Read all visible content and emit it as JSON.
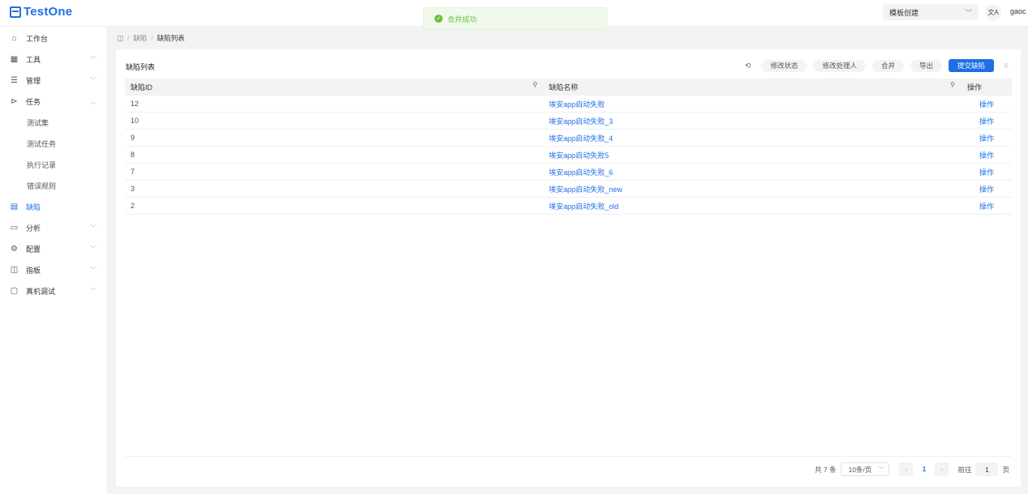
{
  "app": {
    "logo_text": "TestOne"
  },
  "header": {
    "template_select": "模板创建",
    "lang_icon": "文A",
    "user": "gaoc"
  },
  "toast": {
    "message": "合并成功"
  },
  "sidebar": {
    "items": [
      {
        "label": "工作台",
        "icon": "home-icon",
        "glyph": "⌂",
        "chevron": ""
      },
      {
        "label": "工具",
        "icon": "grid-icon",
        "glyph": "▦",
        "chevron": "﹀"
      },
      {
        "label": "管理",
        "icon": "list-icon",
        "glyph": "☰",
        "chevron": "﹀"
      },
      {
        "label": "任务",
        "icon": "send-icon",
        "glyph": "⊳",
        "chevron": "︿"
      },
      {
        "label": "测试集",
        "sub": true
      },
      {
        "label": "测试任务",
        "sub": true
      },
      {
        "label": "执行记录",
        "sub": true
      },
      {
        "label": "错误规则",
        "sub": true
      },
      {
        "label": "缺陷",
        "icon": "document-icon",
        "glyph": "▤",
        "chevron": "",
        "active": true
      },
      {
        "label": "分析",
        "icon": "calendar-icon",
        "glyph": "▭",
        "chevron": "﹀"
      },
      {
        "label": "配置",
        "icon": "gear-icon",
        "glyph": "⚙",
        "chevron": "﹀"
      },
      {
        "label": "指板",
        "icon": "panel-icon",
        "glyph": "◫",
        "chevron": "﹀"
      },
      {
        "label": "真机调试",
        "icon": "device-icon",
        "glyph": "▢",
        "chevron": "﹀"
      }
    ]
  },
  "breadcrumb": {
    "level1": "缺陷",
    "level2": "缺陷列表"
  },
  "card": {
    "title": "缺陷列表",
    "toolbar": {
      "refresh": "⟲",
      "edit_status": "修改状态",
      "edit_handler": "修改处理人",
      "merge": "合并",
      "export": "导出",
      "submit": "提交缺陷"
    }
  },
  "table": {
    "headers": {
      "id": "缺陷ID",
      "name": "缺陷名称",
      "op": "操作"
    },
    "rows": [
      {
        "id": "12",
        "name": "埃安app启动失败",
        "op": "操作"
      },
      {
        "id": "10",
        "name": "埃安app启动失败_3",
        "op": "操作"
      },
      {
        "id": "9",
        "name": "埃安app启动失败_4",
        "op": "操作"
      },
      {
        "id": "8",
        "name": "埃安app启动失败5",
        "op": "操作"
      },
      {
        "id": "7",
        "name": "埃安app启动失败_6",
        "op": "操作"
      },
      {
        "id": "3",
        "name": "埃安app启动失败_new",
        "op": "操作"
      },
      {
        "id": "2",
        "name": "埃安app启动失败_old",
        "op": "操作"
      }
    ]
  },
  "pagination": {
    "total": "共 7 条",
    "page_size": "10条/页",
    "current": "1",
    "goto_label": "前往",
    "goto_value": "1",
    "page_suffix": "页"
  },
  "colors": {
    "accent": "#1f6fe5",
    "success": "#67c23a"
  }
}
